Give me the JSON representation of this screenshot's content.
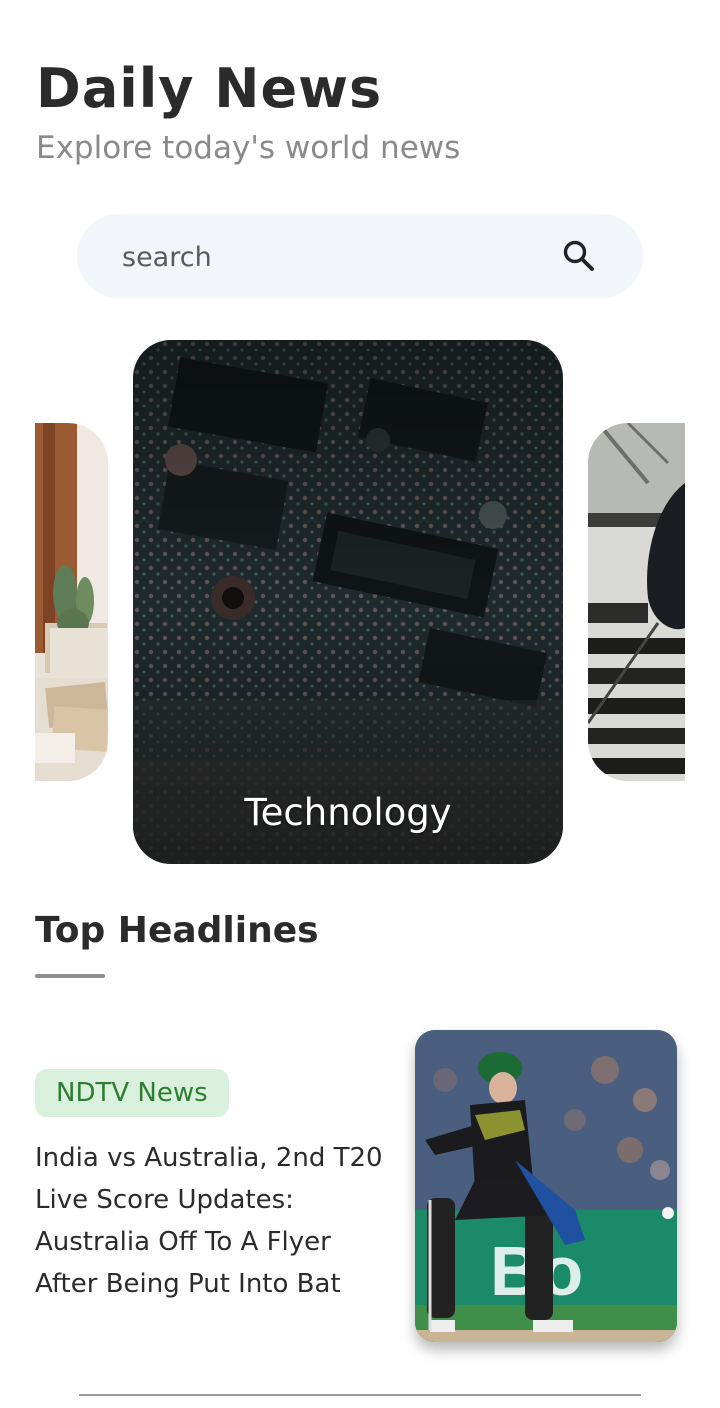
{
  "header": {
    "title": "Daily News",
    "subtitle": "Explore today's world news"
  },
  "search": {
    "placeholder": "search",
    "icon": "search-icon"
  },
  "categories": [
    {
      "label": "",
      "icon": "cactus-desk-photo"
    },
    {
      "label": "Technology",
      "icon": "circuit-board-photo"
    },
    {
      "label": "",
      "icon": "stadium-stairs-photo"
    }
  ],
  "top_headlines": {
    "title": "Top Headlines",
    "articles": [
      {
        "source": "NDTV News",
        "headline": "India vs Australia, 2nd T20 Live Score Updates: Australia Off To A Flyer After Being Put Into Bat",
        "image": "cricket-batsman-photo"
      }
    ]
  },
  "colors": {
    "badge_bg": "#d9f0dc",
    "badge_text": "#2e7d32",
    "search_bg": "#f2f5fa"
  }
}
